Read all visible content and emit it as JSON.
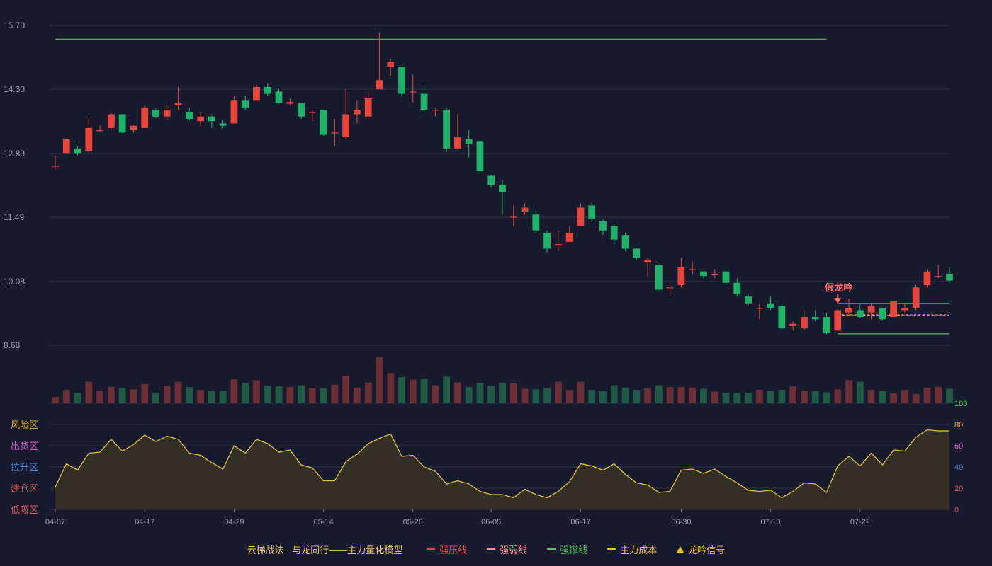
{
  "chart_data": {
    "type": "candlestick",
    "main_axis": {
      "ylim": [
        8.68,
        15.7
      ],
      "ticks": [
        "15.70",
        "14.30",
        "12.89",
        "11.49",
        "10.08",
        "8.68"
      ]
    },
    "dates": [
      "04-07",
      "04-08",
      "04-09",
      "04-10",
      "04-11",
      "04-14",
      "04-15",
      "04-16",
      "04-17",
      "04-18",
      "04-21",
      "04-22",
      "04-23",
      "04-24",
      "04-25",
      "04-28",
      "04-29",
      "04-30",
      "05-06",
      "05-07",
      "05-08",
      "05-09",
      "05-12",
      "05-13",
      "05-14",
      "05-15",
      "05-16",
      "05-19",
      "05-20",
      "05-21",
      "05-22",
      "05-23",
      "05-26",
      "05-27",
      "05-28",
      "05-29",
      "05-30",
      "06-03",
      "06-04",
      "06-05",
      "06-06",
      "06-09",
      "06-10",
      "06-11",
      "06-12",
      "06-13",
      "06-16",
      "06-17",
      "06-18",
      "06-19",
      "06-20",
      "06-23",
      "06-24",
      "06-25",
      "06-26",
      "06-27",
      "06-30",
      "07-01",
      "07-02",
      "07-03",
      "07-04",
      "07-07",
      "07-08",
      "07-09",
      "07-10",
      "07-11",
      "07-14",
      "07-15",
      "07-16",
      "07-17",
      "07-18",
      "07-21",
      "07-22",
      "07-23",
      "07-24",
      "07-25",
      "07-28",
      "07-29",
      "07-30",
      "07-31",
      "08-01"
    ],
    "x_ticks": [
      "04-07",
      "04-17",
      "04-29",
      "05-14",
      "05-26",
      "06-05",
      "06-17",
      "06-30",
      "07-10",
      "07-22"
    ],
    "ohlc": [
      [
        12.6,
        12.62,
        12.55,
        12.85
      ],
      [
        12.9,
        13.2,
        12.9,
        13.2
      ],
      [
        13.0,
        12.9,
        12.85,
        13.05
      ],
      [
        12.95,
        13.45,
        12.9,
        13.7
      ],
      [
        13.4,
        13.4,
        13.35,
        13.5
      ],
      [
        13.45,
        13.75,
        13.4,
        13.78
      ],
      [
        13.75,
        13.35,
        13.33,
        13.75
      ],
      [
        13.4,
        13.5,
        13.35,
        13.52
      ],
      [
        13.45,
        13.9,
        13.45,
        13.95
      ],
      [
        13.85,
        13.7,
        13.66,
        13.88
      ],
      [
        13.7,
        13.85,
        13.63,
        13.95
      ],
      [
        13.95,
        14.0,
        13.85,
        14.35
      ],
      [
        13.8,
        13.65,
        13.62,
        13.9
      ],
      [
        13.6,
        13.7,
        13.5,
        13.8
      ],
      [
        13.7,
        13.6,
        13.45,
        13.75
      ],
      [
        13.55,
        13.5,
        13.45,
        13.62
      ],
      [
        13.55,
        14.05,
        13.55,
        14.15
      ],
      [
        14.05,
        13.9,
        13.84,
        14.15
      ],
      [
        14.05,
        14.35,
        14.05,
        14.4
      ],
      [
        14.35,
        14.2,
        14.15,
        14.42
      ],
      [
        14.25,
        14.0,
        13.98,
        14.3
      ],
      [
        13.98,
        14.02,
        13.95,
        14.1
      ],
      [
        14.0,
        13.7,
        13.65,
        14.0
      ],
      [
        13.78,
        13.8,
        13.6,
        13.85
      ],
      [
        13.85,
        13.3,
        13.28,
        13.85
      ],
      [
        13.33,
        13.35,
        13.05,
        13.65
      ],
      [
        13.25,
        13.75,
        13.2,
        14.3
      ],
      [
        13.75,
        13.85,
        13.55,
        14.05
      ],
      [
        13.7,
        14.1,
        13.65,
        14.25
      ],
      [
        14.3,
        14.5,
        14.3,
        15.55
      ],
      [
        14.8,
        14.9,
        14.6,
        14.96
      ],
      [
        14.8,
        14.2,
        14.13,
        14.8
      ],
      [
        14.25,
        14.25,
        14.0,
        14.62
      ],
      [
        14.2,
        13.85,
        13.77,
        14.42
      ],
      [
        13.85,
        13.85,
        13.7,
        13.9
      ],
      [
        13.85,
        13.0,
        12.92,
        13.9
      ],
      [
        13.0,
        13.25,
        12.98,
        13.76
      ],
      [
        13.2,
        13.1,
        12.8,
        13.4
      ],
      [
        13.15,
        12.5,
        12.45,
        13.15
      ],
      [
        12.4,
        12.2,
        12.15,
        12.42
      ],
      [
        12.2,
        12.05,
        11.55,
        12.3
      ],
      [
        11.5,
        11.5,
        11.3,
        11.75
      ],
      [
        11.6,
        11.7,
        11.55,
        11.8
      ],
      [
        11.55,
        11.2,
        11.15,
        11.7
      ],
      [
        11.15,
        10.8,
        10.72,
        11.2
      ],
      [
        10.9,
        10.9,
        10.75,
        11.2
      ],
      [
        10.95,
        11.15,
        10.95,
        11.3
      ],
      [
        11.3,
        11.7,
        11.3,
        11.8
      ],
      [
        11.75,
        11.45,
        11.4,
        11.8
      ],
      [
        11.4,
        11.2,
        11.1,
        11.45
      ],
      [
        11.3,
        11.0,
        10.9,
        11.35
      ],
      [
        11.1,
        10.8,
        10.75,
        11.15
      ],
      [
        10.8,
        10.6,
        10.55,
        10.82
      ],
      [
        10.5,
        10.55,
        10.2,
        10.6
      ],
      [
        10.45,
        9.9,
        9.88,
        10.45
      ],
      [
        9.95,
        9.95,
        9.75,
        10.05
      ],
      [
        10.0,
        10.4,
        9.95,
        10.6
      ],
      [
        10.35,
        10.35,
        10.25,
        10.5
      ],
      [
        10.3,
        10.2,
        10.15,
        10.3
      ],
      [
        10.25,
        10.25,
        10.15,
        10.35
      ],
      [
        10.3,
        10.05,
        10.0,
        10.4
      ],
      [
        10.05,
        9.8,
        9.75,
        10.15
      ],
      [
        9.75,
        9.6,
        9.55,
        9.8
      ],
      [
        9.5,
        9.5,
        9.25,
        9.6
      ],
      [
        9.6,
        9.5,
        9.45,
        9.75
      ],
      [
        9.55,
        9.05,
        9.03,
        9.6
      ],
      [
        9.1,
        9.15,
        9.0,
        9.2
      ],
      [
        9.05,
        9.3,
        9.02,
        9.45
      ],
      [
        9.3,
        9.25,
        9.2,
        9.45
      ],
      [
        9.3,
        8.95,
        8.92,
        9.4
      ],
      [
        9.0,
        9.45,
        8.99,
        9.47
      ],
      [
        9.4,
        9.5,
        9.35,
        9.7
      ],
      [
        9.45,
        9.3,
        9.28,
        9.6
      ],
      [
        9.4,
        9.55,
        9.25,
        9.6
      ],
      [
        9.5,
        9.25,
        9.22,
        9.5
      ],
      [
        9.3,
        9.65,
        9.3,
        9.66
      ],
      [
        9.45,
        9.5,
        9.4,
        9.6
      ],
      [
        9.5,
        9.95,
        9.45,
        10.0
      ],
      [
        10.0,
        10.3,
        9.95,
        10.35
      ],
      [
        10.2,
        10.2,
        10.15,
        10.45
      ],
      [
        10.25,
        10.1,
        10.05,
        10.4
      ]
    ],
    "volume": [
      11,
      23,
      18,
      37,
      22,
      28,
      26,
      24,
      33,
      18,
      30,
      37,
      28,
      23,
      22,
      22,
      41,
      35,
      40,
      30,
      29,
      28,
      31,
      26,
      26,
      32,
      47,
      27,
      36,
      80,
      52,
      45,
      41,
      42,
      31,
      46,
      36,
      28,
      35,
      30,
      35,
      34,
      25,
      24,
      26,
      37,
      23,
      37,
      23,
      21,
      31,
      27,
      23,
      26,
      31,
      28,
      28,
      27,
      25,
      20,
      18,
      18,
      18,
      23,
      22,
      23,
      29,
      22,
      21,
      19,
      24,
      40,
      37,
      23,
      21,
      17,
      23,
      16,
      27,
      28,
      25
    ],
    "volume_axis": {
      "ylim": [
        0,
        100
      ]
    },
    "signal_line": [
      21,
      43,
      37,
      53,
      54,
      66,
      55,
      61,
      70,
      64,
      69,
      66,
      53,
      51,
      44,
      38,
      60,
      53,
      66,
      62,
      54,
      56,
      42,
      39,
      27,
      27,
      45,
      52,
      62,
      67,
      71,
      50,
      51,
      40,
      36,
      24,
      27,
      24,
      17,
      14,
      14,
      11,
      19,
      14,
      11,
      17,
      26,
      43,
      41,
      37,
      43,
      33,
      25,
      23,
      16,
      17,
      37,
      38,
      34,
      38,
      31,
      25,
      18,
      17,
      18,
      11,
      17,
      25,
      24,
      16,
      41,
      50,
      41,
      53,
      42,
      56,
      55,
      68,
      75,
      74,
      74
    ],
    "signal_axis": {
      "ylim": [
        0,
        80
      ],
      "ticks": [
        "80",
        "60",
        "40",
        "20",
        "0"
      ]
    },
    "zones": [
      "风险区",
      "出货区",
      "拉升区",
      "建仓区",
      "低吸区"
    ],
    "zone_colors": [
      "#e8a63a",
      "#d65bd8",
      "#3e8de0",
      "#e05a5a",
      "#e05a5a"
    ],
    "volume_top_label": "100",
    "lines": {
      "support_top": 15.4,
      "pressure": 9.6,
      "weak": 9.35,
      "cost": 9.33,
      "support_bottom": 8.93
    },
    "annotation": {
      "text": "假龙吟",
      "date": "07-18"
    },
    "colors": {
      "up": "#e8453c",
      "down": "#1fb36a",
      "support": "#57c25a",
      "pressure": "#e8453c",
      "weak": "#ff8a8a",
      "cost": "#f4c21d",
      "signal": "#e3c23a",
      "grid": "#2f3347",
      "volume_top_label": "#4cd45b"
    }
  },
  "legend": {
    "model": "云梯战法 · 与龙同行——主力量化模型",
    "items": [
      {
        "label": "强压线",
        "color": "#e8453c",
        "style": "line"
      },
      {
        "label": "强弱线",
        "color": "#ff8a8a",
        "style": "dash"
      },
      {
        "label": "强撑线",
        "color": "#57c25a",
        "style": "line"
      },
      {
        "label": "主力成本",
        "color": "#f4c21d",
        "style": "dash"
      },
      {
        "label": "龙吟信号",
        "color": "#f4c21d",
        "style": "triangle"
      }
    ]
  }
}
